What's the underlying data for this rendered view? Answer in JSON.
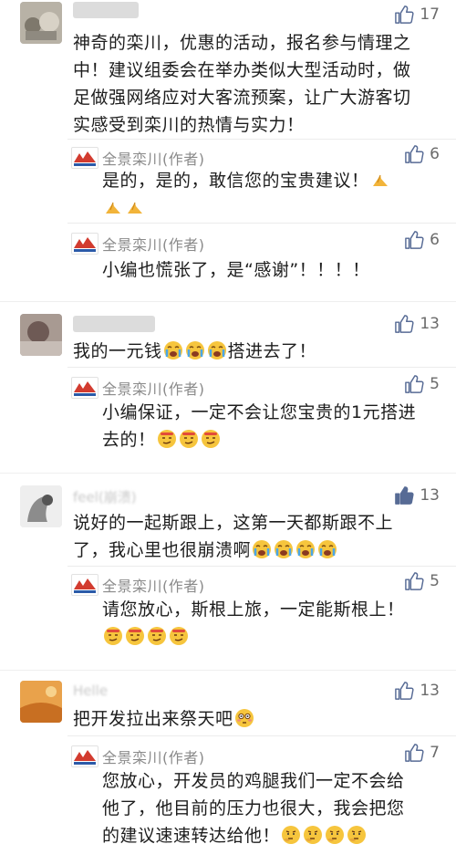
{
  "comments": [
    {
      "likes": "17",
      "text_lines": [
        "神奇的栾川，优惠的活动，报名参与情理之",
        "中！建议组委会在举办类似大型活动时，做",
        "足做强网络应对大客流预案，让广大游客切",
        "实感受到栾川的热情与实力！"
      ],
      "replies": [
        {
          "author": "全景栾川(作者)",
          "likes": "6",
          "text": "是的，是的，敢信您的宝贵建议！"
        },
        {
          "author": "全景栾川(作者)",
          "likes": "6",
          "text": "小编也慌张了，是“感谢”！！！！"
        }
      ]
    },
    {
      "likes": "13",
      "text_before": "我的一元钱",
      "text_after": "搭进去了！",
      "replies": [
        {
          "author": "全景栾川(作者)",
          "likes": "5",
          "text_lines": [
            "小编保证，一定不会让您宝贵的1元搭进",
            "去的！"
          ]
        }
      ]
    },
    {
      "likes": "13",
      "username": "feel(崩溃)",
      "text_lines": [
        "说好的一起斯跟上，这第一天都斯跟不上",
        "了，我心里也很崩溃啊"
      ],
      "replies": [
        {
          "author": "全景栾川(作者)",
          "likes": "5",
          "text": "请您放心，斯根上旅，一定能斯根上！"
        }
      ]
    },
    {
      "likes": "13",
      "username": "Helle",
      "text": "把开发拉出来祭天吧",
      "replies": [
        {
          "author": "全景栾川(作者)",
          "likes": "7",
          "text_lines": [
            "您放心，开发员的鸡腿我们一定不会给",
            "他了，他目前的压力也很大，我会把您",
            "的建议速速转达给他！"
          ]
        }
      ]
    }
  ],
  "colors": {
    "text": "#1d1d1d",
    "muted": "#8a8a8a",
    "like_icon": "#576b95",
    "like_icon_filled": "#576b95"
  }
}
